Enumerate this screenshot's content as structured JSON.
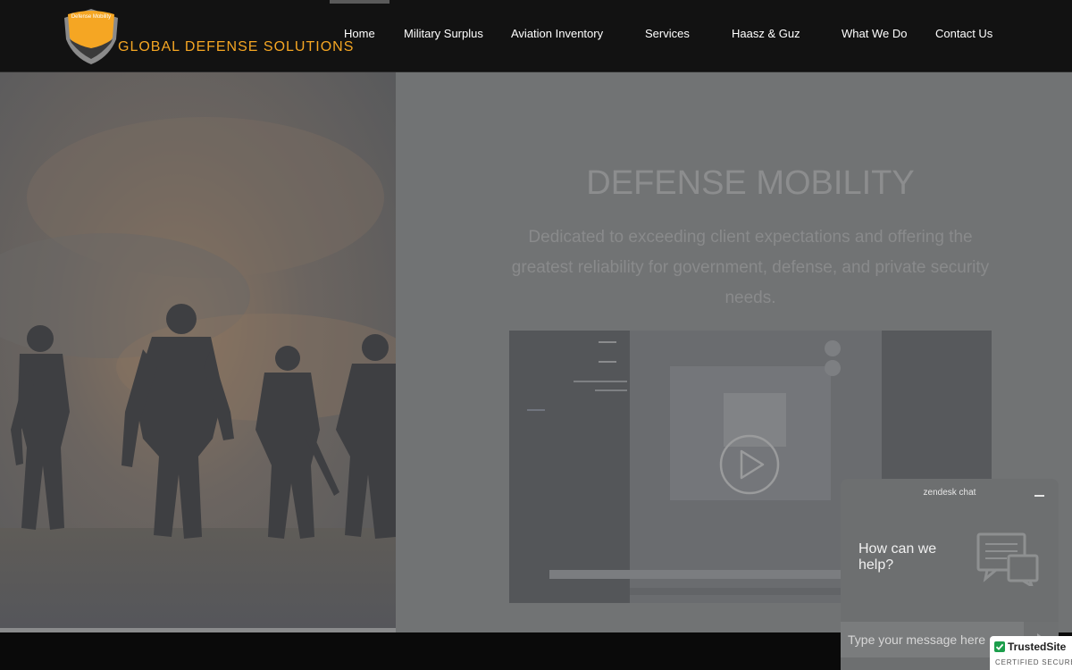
{
  "header": {
    "logo_text": "Defense Mobility",
    "brand": "GLOBAL DEFENSE SOLUTIONS"
  },
  "nav": {
    "items": [
      {
        "label": "Home",
        "active": true
      },
      {
        "label": "Military Surplus"
      },
      {
        "label": "Aviation Inventory"
      },
      {
        "label": "Services"
      },
      {
        "label": "Haasz & Guz"
      },
      {
        "label": "What We Do"
      },
      {
        "label": "Contact Us"
      }
    ]
  },
  "hero": {
    "title": "DEFENSE MOBILITY",
    "subtitle": "Dedicated to exceeding client expectations and offering the greatest reliability for government, defense, and private security needs.",
    "video": {
      "play_icon": "play-circle-icon"
    }
  },
  "chat": {
    "title": "zendesk chat",
    "prompt": "How can we help?",
    "input_placeholder": "Type your message here"
  },
  "badge": {
    "name": "TrustedSite",
    "sub": "CERTIFIED SECURE"
  },
  "colors": {
    "brand_orange": "#f5a623",
    "header_bg": "#121212",
    "overlay_gray": "#717374"
  }
}
